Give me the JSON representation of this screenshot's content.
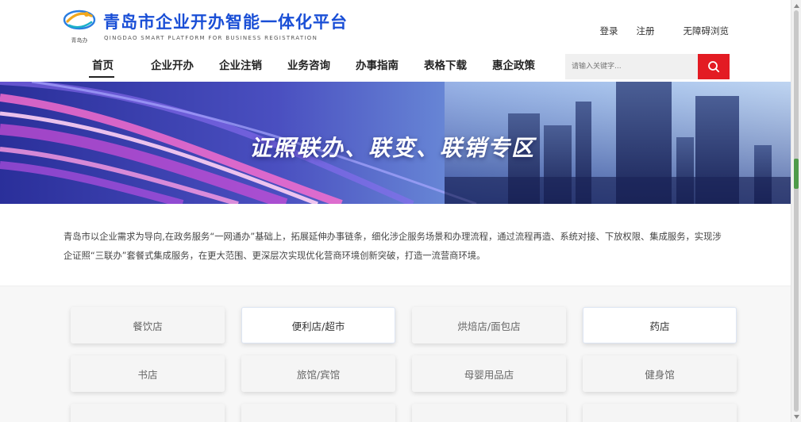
{
  "header": {
    "logo_text": "青岛办",
    "title": "青岛市企业开办智能一体化平台",
    "subtitle": "QINGDAO SMART PLATFORM FOR BUSINESS REGISTRATION",
    "top_links": {
      "login": "登录",
      "register": "注册",
      "accessible": "无障碍浏览"
    },
    "nav": [
      {
        "label": "首页",
        "active": true
      },
      {
        "label": "企业开办",
        "active": false
      },
      {
        "label": "企业注销",
        "active": false
      },
      {
        "label": "业务咨询",
        "active": false
      },
      {
        "label": "办事指南",
        "active": false
      },
      {
        "label": "表格下载",
        "active": false
      },
      {
        "label": "惠企政策",
        "active": false
      }
    ],
    "search": {
      "placeholder": "请输入关键字...",
      "icon": "search-icon"
    }
  },
  "banner": {
    "title": "证照联办、联变、联销专区"
  },
  "intro": {
    "line1": "青岛市以企业需求为导向,在政务服务“一网通办”基础上，拓展延伸办事链条，细化涉企服务场景和办理流程，通过流程再造、系统对接、下放权限、集成服务，实现涉",
    "line2": "企证照“三联办”套餐式集成服务，在更大范围、更深层次实现优化营商环境创新突破，打造一流营商环境。"
  },
  "categories": {
    "row1": [
      "餐饮店",
      "便利店/超市",
      "烘焙店/面包店",
      "药店"
    ],
    "row2": [
      "书店",
      "旅馆/宾馆",
      "母婴用品店",
      "健身馆"
    ]
  },
  "colors": {
    "brand_blue": "#1a4fd6",
    "search_red": "#e31b23",
    "scroll_marker": "#4f9b4a"
  }
}
